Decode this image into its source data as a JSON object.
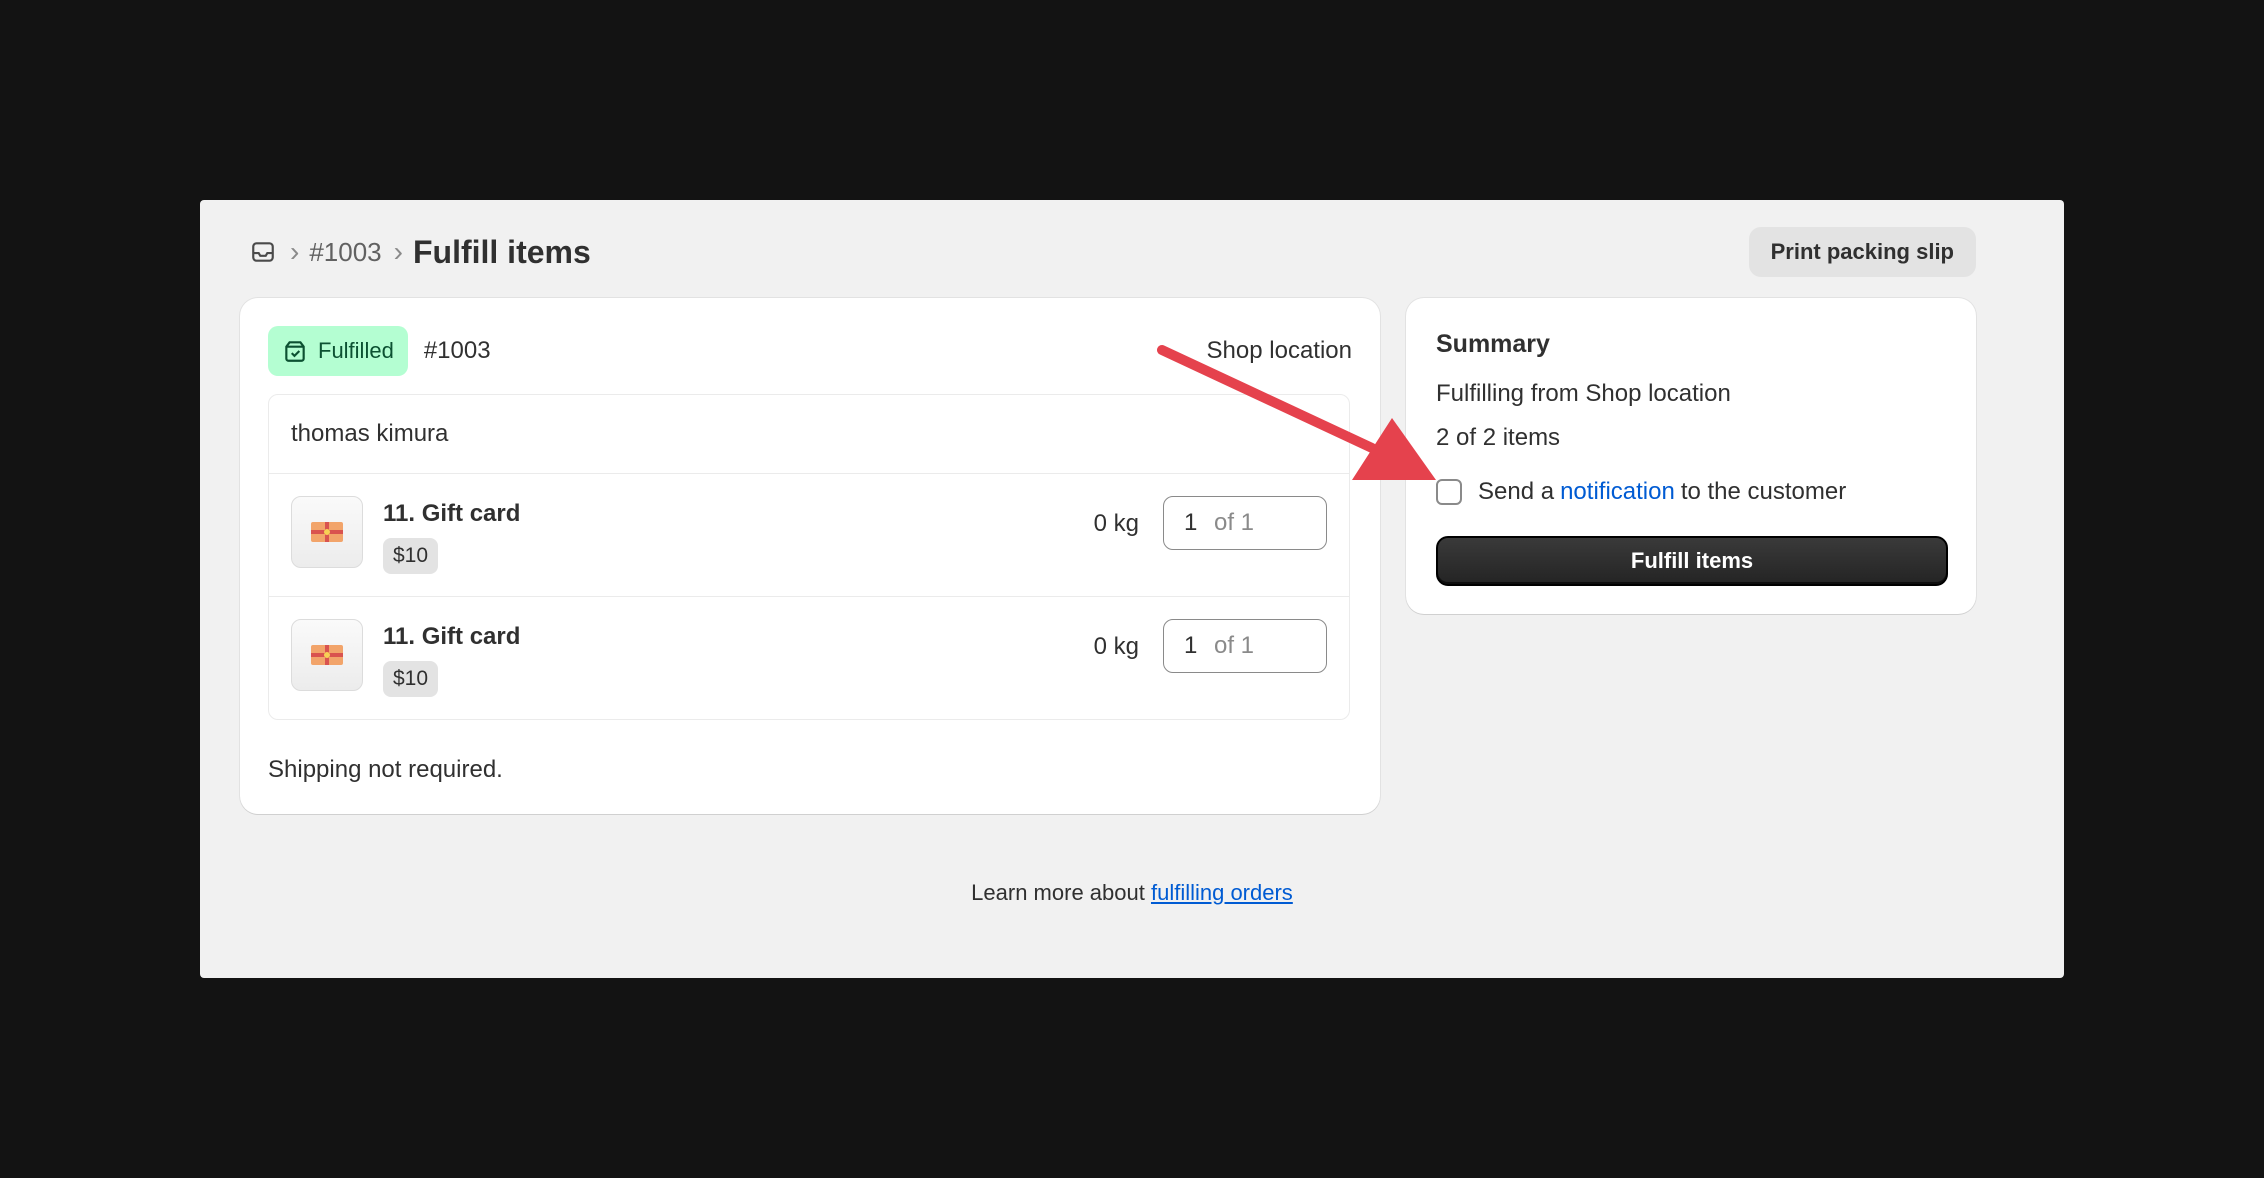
{
  "header": {
    "breadcrumb_order": "#1003",
    "title": "Fulfill items",
    "print_button_label": "Print packing slip",
    "home_icon": "orders-inbox-icon"
  },
  "fulfillment": {
    "status_badge": "Fulfilled",
    "status_icon": "fulfilled-package-icon",
    "order_id": "#1003",
    "location": "Shop location",
    "customer": "thomas kimura",
    "items": [
      {
        "name": "11. Gift card",
        "price": "$10",
        "weight": "0 kg",
        "quantity": "1",
        "of_total": "of 1"
      },
      {
        "name": "11. Gift card",
        "price": "$10",
        "weight": "0 kg",
        "quantity": "1",
        "of_total": "of 1"
      }
    ],
    "shipping_note": "Shipping not required."
  },
  "summary": {
    "title": "Summary",
    "line1": "Fulfilling from Shop location",
    "line2": "2 of 2 items",
    "notify_prefix": "Send a",
    "notify_link": "notification",
    "notify_suffix": "to the customer",
    "notify_checked": false,
    "fulfill_button_label": "Fulfill items"
  },
  "footer": {
    "learn_prefix": "Learn more about",
    "learn_link": "fulfilling orders"
  },
  "colors": {
    "badge_bg": "#b4fed2",
    "link": "#005bd3",
    "annotation_arrow": "#e5424d"
  }
}
